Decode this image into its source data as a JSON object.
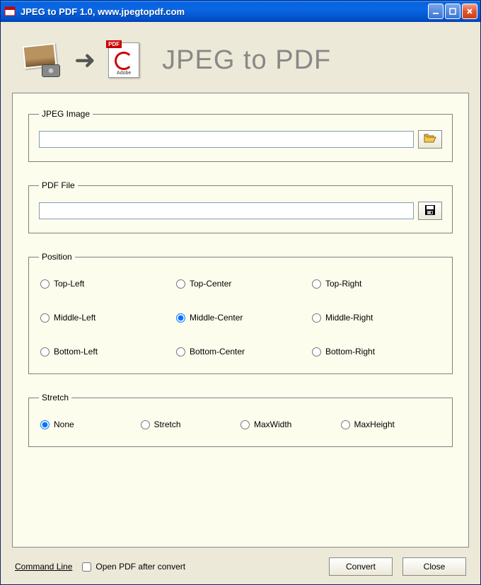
{
  "window": {
    "title": "JPEG to PDF 1.0, www.jpegtopdf.com"
  },
  "banner": {
    "heading": "JPEG to PDF",
    "pdf_badge": "PDF",
    "pdf_brand": "Adobe"
  },
  "groups": {
    "jpeg_image": {
      "legend": "JPEG Image",
      "value": ""
    },
    "pdf_file": {
      "legend": "PDF File",
      "value": ""
    },
    "position": {
      "legend": "Position",
      "options": [
        "Top-Left",
        "Top-Center",
        "Top-Right",
        "Middle-Left",
        "Middle-Center",
        "Middle-Right",
        "Bottom-Left",
        "Bottom-Center",
        "Bottom-Right"
      ],
      "selected": "Middle-Center"
    },
    "stretch": {
      "legend": "Stretch",
      "options": [
        "None",
        "Stretch",
        "MaxWidth",
        "MaxHeight"
      ],
      "selected": "None"
    }
  },
  "footer": {
    "command_line": "Command Line",
    "open_after_label": "Open PDF after convert",
    "open_after_checked": false,
    "convert": "Convert",
    "close": "Close"
  }
}
